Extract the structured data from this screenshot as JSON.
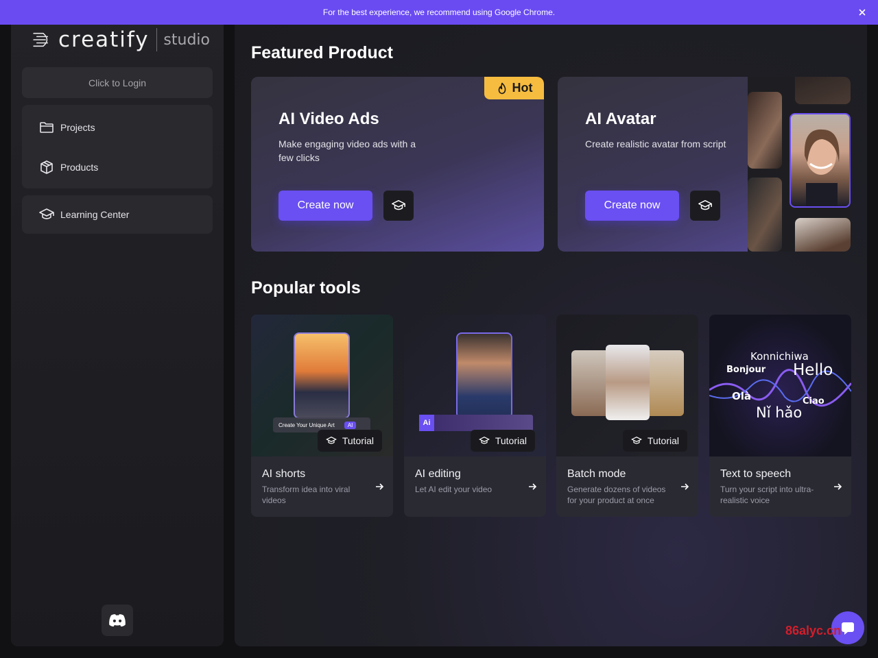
{
  "banner": {
    "text": "For the best experience, we recommend using Google Chrome.",
    "close_icon": "close-icon"
  },
  "sidebar": {
    "logo_word": "creatify",
    "logo_suffix": "studio",
    "login_label": "Click to Login",
    "items": [
      {
        "label": "Projects",
        "icon": "folder-icon"
      },
      {
        "label": "Products",
        "icon": "box-icon"
      },
      {
        "label": "Learning Center",
        "icon": "graduation-cap-icon"
      }
    ],
    "discord_icon": "discord-icon"
  },
  "featured": {
    "title": "Featured Product",
    "cards": [
      {
        "title": "AI Video Ads",
        "desc": "Make engaging video ads with a few clicks",
        "cta": "Create now",
        "badge": "Hot"
      },
      {
        "title": "AI Avatar",
        "desc": "Create realistic avatar from script",
        "cta": "Create now"
      }
    ]
  },
  "tools": {
    "title": "Popular tools",
    "tutorial_label": "Tutorial",
    "items": [
      {
        "name": "AI shorts",
        "desc": "Transform idea into viral videos",
        "thumb_text": "Create Your Unique Art",
        "thumb_badge": "AI",
        "has_tutorial": true
      },
      {
        "name": "AI editing",
        "desc": "Let AI edit your video",
        "thumb_badge": "Ai",
        "has_tutorial": true
      },
      {
        "name": "Batch mode",
        "desc": "Generate dozens of videos for your product at once",
        "has_tutorial": true
      },
      {
        "name": "Text to speech",
        "desc": "Turn your script into ultra-realistic voice",
        "has_tutorial": false,
        "words": [
          "Konnichiwa",
          "Bonjour",
          "Hello",
          "Olà",
          "Ciao",
          "Nǐ hǎo"
        ]
      }
    ]
  },
  "watermark": "86alyc.cn",
  "colors": {
    "accent": "#6a4ff2",
    "banner": "#6a4bf2",
    "hot": "#f6bc3f"
  }
}
